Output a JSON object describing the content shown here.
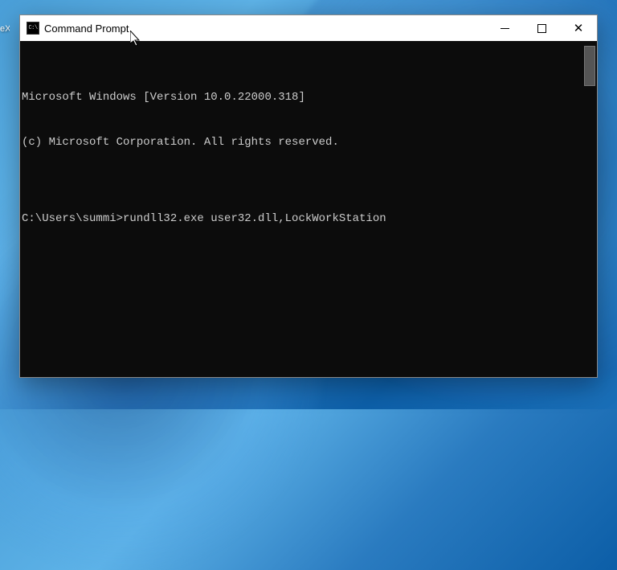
{
  "desktop": {
    "partial_text": "eX"
  },
  "window": {
    "title": "Command Prompt",
    "icon_text": "C:\\"
  },
  "terminal": {
    "line1": "Microsoft Windows [Version 10.0.22000.318]",
    "line2": "(c) Microsoft Corporation. All rights reserved.",
    "blank": "",
    "prompt_line": "C:\\Users\\summi>rundll32.exe user32.dll,LockWorkStation"
  }
}
